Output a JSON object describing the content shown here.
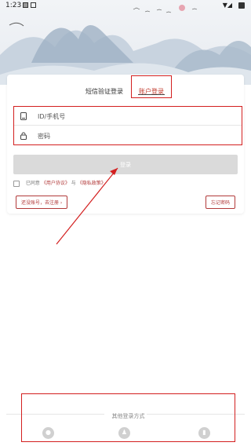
{
  "statusbar": {
    "time": "1:23"
  },
  "tabs": {
    "sms": "短信验证登录",
    "account": "账户登录"
  },
  "fields": {
    "id_placeholder": "ID/手机号",
    "password_placeholder": "密码"
  },
  "login_button": "登录",
  "agreement": {
    "prefix": "已同意",
    "user_agreement": "《用户协议》",
    "and": "与",
    "privacy_policy": "《隐私政策》"
  },
  "register_button": "还没账号，去注册 ›",
  "forgot_button": "忘记密码",
  "other_login": {
    "title": "其他登录方式",
    "options": [
      "wechat-icon",
      "qq-icon",
      "phone-icon"
    ]
  },
  "colors": {
    "highlight_red": "#d31f1f",
    "link_red": "#b23a3a",
    "button_gray": "#dadada"
  }
}
